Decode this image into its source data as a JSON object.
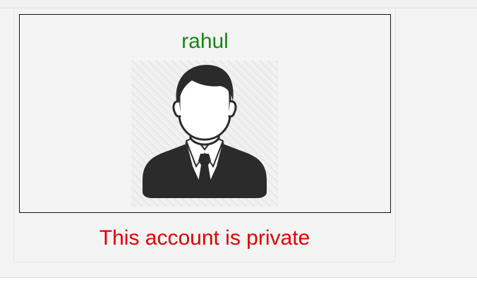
{
  "profile": {
    "username": "rahul",
    "avatar_icon": "person-in-suit-avatar-icon",
    "private_message": "This account is private"
  },
  "colors": {
    "username": "#138a13",
    "private_message": "#e00000",
    "panel_background": "#f4f4f4",
    "avatar_dark": "#2b2b2b"
  }
}
